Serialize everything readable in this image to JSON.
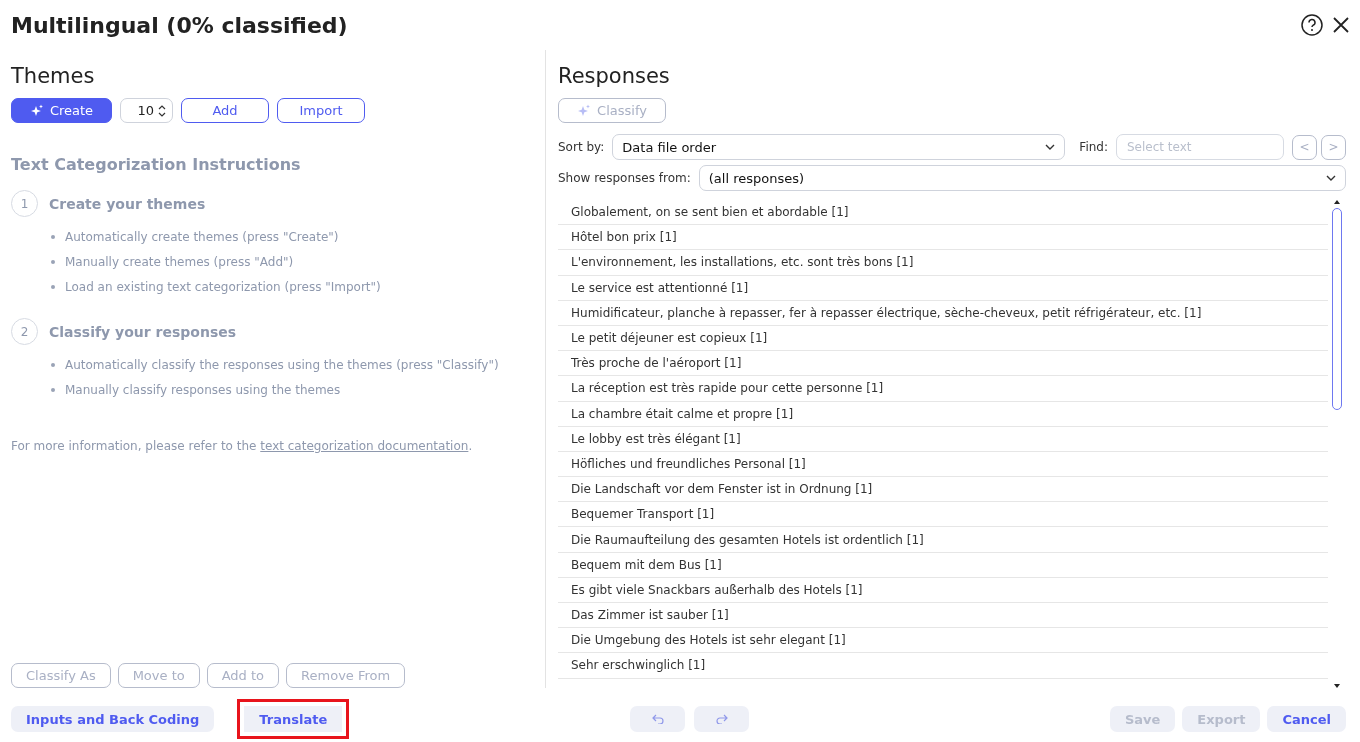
{
  "window": {
    "title": "Multilingual (0% classified)"
  },
  "themes": {
    "title": "Themes",
    "create_button": {
      "label": "Create",
      "disabled": false
    },
    "count": "10",
    "buttons": [
      {
        "label": "Add",
        "disabled": false
      },
      {
        "label": "Import",
        "disabled": false
      }
    ]
  },
  "instructions": {
    "title": "Text Categorization Instructions",
    "steps": [
      {
        "number": "1",
        "title": "Create your themes",
        "items": [
          "Automatically create themes (press \"Create\")",
          "Manually create themes (press \"Add\")",
          "Load an existing text categorization (press \"Import\")"
        ]
      },
      {
        "number": "2",
        "title": "Classify your responses",
        "items": [
          "Automatically classify the responses using the themes (press \"Classify\")",
          "Manually classify responses using the themes"
        ]
      }
    ],
    "footer_text": "For more information, please refer to the ",
    "footer_link": "text categorization documentation",
    "footer_end": "."
  },
  "theme_actions": [
    {
      "label": "Classify As",
      "disabled": true
    },
    {
      "label": "Move to",
      "disabled": true
    },
    {
      "label": "Add to",
      "disabled": true
    },
    {
      "label": "Remove From",
      "disabled": true
    }
  ],
  "responses": {
    "title": "Responses",
    "classify_button": {
      "label": "Classify",
      "disabled": true
    },
    "sort_label": "Sort by:",
    "sort_value": "Data file order",
    "find_label": "Find:",
    "find_placeholder": "Select text",
    "prev": "<",
    "next": ">",
    "show_label": "Show responses from:",
    "show_value": "(all responses)",
    "rows": [
      "Globalement, on se sent bien et abordable [1]",
      "Hôtel bon prix [1]",
      "L'environnement, les installations, etc. sont très bons [1]",
      "Le service est attentionné [1]",
      "Humidificateur, planche à repasser, fer à repasser électrique, sèche-cheveux, petit réfrigérateur, etc. [1]",
      "Le petit déjeuner est copieux [1]",
      "Très proche de l'aéroport [1]",
      "La réception est très rapide pour cette personne [1]",
      "La chambre était calme et propre [1]",
      "Le lobby est très élégant [1]",
      "Höfliches und freundliches Personal [1]",
      "Die Landschaft vor dem Fenster ist in Ordnung [1]",
      "Bequemer Transport [1]",
      "Die Raumaufteilung des gesamten Hotels ist ordentlich [1]",
      "Bequem mit dem Bus [1]",
      "Es gibt viele Snackbars außerhalb des Hotels [1]",
      "Das Zimmer ist sauber [1]",
      "Die Umgebung des Hotels ist sehr elegant [1]",
      "Sehr erschwinglich [1]"
    ]
  },
  "footer": {
    "left": [
      {
        "label": "Inputs and Back Coding",
        "highlighted": false
      },
      {
        "label": "Translate",
        "highlighted": true
      }
    ],
    "undo_disabled": true,
    "redo_disabled": true,
    "right": [
      {
        "label": "Save",
        "disabled": true
      },
      {
        "label": "Export",
        "disabled": true
      },
      {
        "label": "Cancel",
        "disabled": false
      }
    ]
  }
}
